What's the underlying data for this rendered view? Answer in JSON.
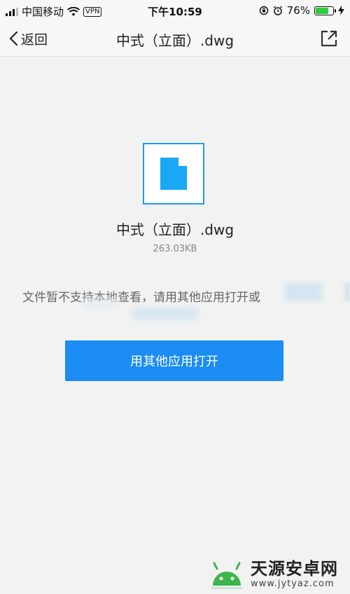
{
  "status_bar": {
    "carrier": "中国移动",
    "vpn": "VPN",
    "time": "下午10:59",
    "battery_percent": "76%",
    "battery_level": 0.76
  },
  "navbar": {
    "back_label": "返回",
    "title": "中式（立面）.dwg",
    "share_icon": "external-share-icon"
  },
  "file": {
    "icon": "document-icon",
    "name": "中式（立面）.dwg",
    "size": "263.03KB"
  },
  "message": "文件暂不支持本地查看，请用其他应用打开或",
  "open_button_label": "用其他应用打开",
  "watermark": {
    "title": "天源安卓网",
    "url": "www.jytyaz.com"
  },
  "colors": {
    "accent": "#1a8cf3",
    "icon_blue": "#1a9ff0",
    "background": "#f2f2f2"
  }
}
